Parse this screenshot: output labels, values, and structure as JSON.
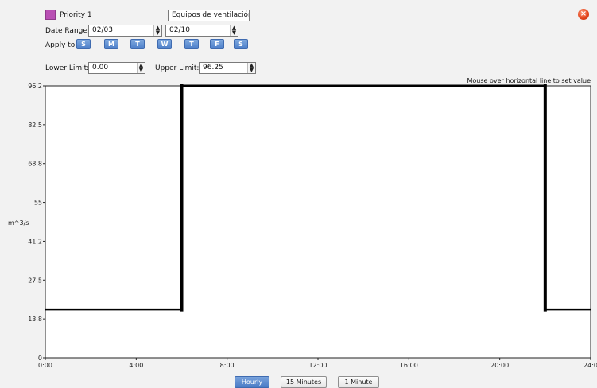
{
  "header": {
    "priority_label": "Priority 1",
    "priority_color": "#b94fb4",
    "schedule_name": "Equipos de ventilación",
    "date_range_label": "Date Range:",
    "date_from": "02/03",
    "date_to": "02/10",
    "apply_to_label": "Apply to:",
    "days": [
      "S",
      "M",
      "T",
      "W",
      "T",
      "F",
      "S"
    ],
    "lower_limit_label": "Lower Limit:",
    "lower_limit_value": "0.00",
    "upper_limit_label": "Upper Limit:",
    "upper_limit_value": "96.25"
  },
  "hint": "Mouse over horizontal line to set value",
  "chart_data": {
    "type": "line",
    "title": "",
    "xlabel": "",
    "ylabel": "m^3/s",
    "x_ticks": [
      "0:00",
      "4:00",
      "8:00",
      "12:00",
      "16:00",
      "20:00",
      "24:0"
    ],
    "x_tick_hours": [
      0,
      4,
      8,
      12,
      16,
      20,
      24
    ],
    "y_ticks": [
      "0",
      "13.8",
      "27.5",
      "41.2",
      "55",
      "68.8",
      "82.5",
      "96.2"
    ],
    "y_tick_values": [
      0,
      13.75,
      27.5,
      41.25,
      55,
      68.75,
      82.5,
      96.25
    ],
    "xlim": [
      0,
      24
    ],
    "ylim": [
      0,
      96.25
    ],
    "grid": false,
    "series": [
      {
        "x": [
          0,
          6,
          6,
          22,
          22,
          24
        ],
        "y": [
          17,
          17,
          96.25,
          96.25,
          17,
          17
        ]
      }
    ]
  },
  "resolution_buttons": [
    "Hourly",
    "15 Minutes",
    "1 Minute"
  ],
  "resolution_selected": "Hourly"
}
